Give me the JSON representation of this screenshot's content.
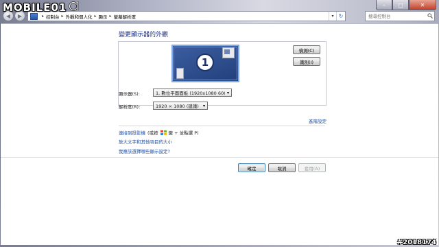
{
  "watermark": {
    "text": "MOBILE01"
  },
  "window": {
    "caption_minimize": "–",
    "caption_maximize": "□",
    "caption_close": "✕"
  },
  "navigation": {
    "back_glyph": "◀",
    "forward_glyph": "▶",
    "dropdown_glyph": "▾",
    "breadcrumbs": [
      "控制台",
      "外觀和個人化",
      "顯示",
      "螢幕解析度"
    ],
    "separator": "▸",
    "refresh_glyph": "↻"
  },
  "search": {
    "placeholder": "搜尋控制台",
    "icon": "search-icon"
  },
  "page": {
    "title": "變更顯示器的外觀",
    "monitor_number": "1",
    "detect_label": "偵測(C)",
    "identify_label": "識別(I)",
    "display_label": "顯示器(S):",
    "display_value": "1. 數位平面面板 (1920x1080 60Hz)",
    "resolution_label": "解析度(R):",
    "resolution_value": "1920 × 1080 (建議)",
    "advanced_link": "進階設定",
    "connect_link": "連接到投影機",
    "connect_hint_pre": "(或按",
    "connect_hint_post": "鍵 + 並點選 P)",
    "text_size_link": "放大文字和其他項目的大小",
    "help_link": "我應該選擇哪些顯示設定?",
    "ok_label": "確定",
    "cancel_label": "取消",
    "apply_label": "套用(A)"
  },
  "colors": {
    "link": "#1f4fa3",
    "title": "#1e3287",
    "monitor": "#2f4f8e"
  },
  "stamp": {
    "text": "#2018174"
  }
}
